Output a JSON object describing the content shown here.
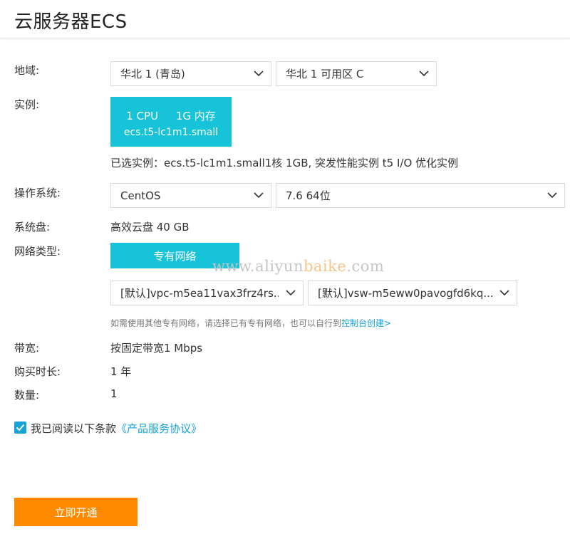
{
  "header": {
    "title": "云服务器ECS"
  },
  "region": {
    "label": "地域:",
    "region_value": "华北 1 (青岛)",
    "zone_value": "华北 1 可用区 C"
  },
  "instance": {
    "label": "实例:",
    "cpu": "1 CPU",
    "memory": "1G 内存",
    "type": "ecs.t5-lc1m1.small",
    "selected_text": "已选实例：ecs.t5-lc1m1.small1核 1GB, 突发性能实例 t5 I/O 优化实例"
  },
  "os": {
    "label": "操作系统:",
    "os_value": "CentOS",
    "version_value": "7.6 64位"
  },
  "disk": {
    "label": "系统盘:",
    "value": "高效云盘 40 GB"
  },
  "network": {
    "label": "网络类型:",
    "type_button": "专有网络",
    "vpc_value": "[默认]vpc-m5ea11vax3frz4rs...",
    "vsw_value": "[默认]vsw-m5eww0pavogfd6kq...",
    "hint": "如需使用其他专有网络，请选择已有专有网络，也可以自行到",
    "hint_link": "控制台创建>"
  },
  "watermark": {
    "prefix": "www.aliyun",
    "accent": "baike",
    "suffix": ".com"
  },
  "bandwidth": {
    "label": "带宽:",
    "value": "按固定带宽1 Mbps"
  },
  "duration": {
    "label": "购买时长:",
    "value": "1 年"
  },
  "quantity": {
    "label": "数量:",
    "value": "1"
  },
  "agreement": {
    "checked": true,
    "text": "我已阅读以下条款",
    "link": "《产品服务协议》"
  },
  "submit": {
    "label": "立即开通"
  },
  "colors": {
    "accent": "#17c3d8",
    "link": "#17a3d8",
    "submit": "#ff8a00"
  }
}
